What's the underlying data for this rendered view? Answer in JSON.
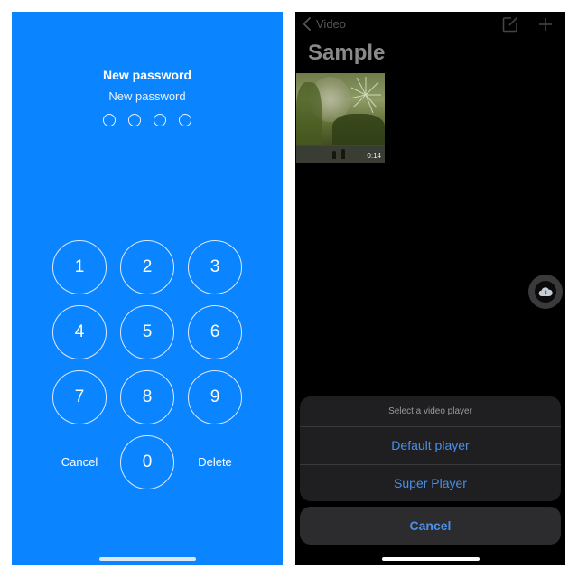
{
  "passcode_screen": {
    "background_color": "#0a84ff",
    "title": "New password",
    "subtitle": "New password",
    "entered_digits": 0,
    "total_digits": 4,
    "keys": [
      "1",
      "2",
      "3",
      "4",
      "5",
      "6",
      "7",
      "8",
      "9",
      "0"
    ],
    "cancel_label": "Cancel",
    "delete_label": "Delete"
  },
  "video_screen": {
    "nav": {
      "back_label": "Video",
      "icons": [
        "compose-icon",
        "plus-icon"
      ]
    },
    "title": "Sample",
    "videos": [
      {
        "duration": "0:14"
      }
    ],
    "floating_button_icon": "cloud-icon",
    "action_sheet": {
      "title": "Select a video player",
      "options": [
        "Default player",
        "Super Player"
      ],
      "cancel_label": "Cancel",
      "accent_color": "#4a8fe8"
    }
  }
}
